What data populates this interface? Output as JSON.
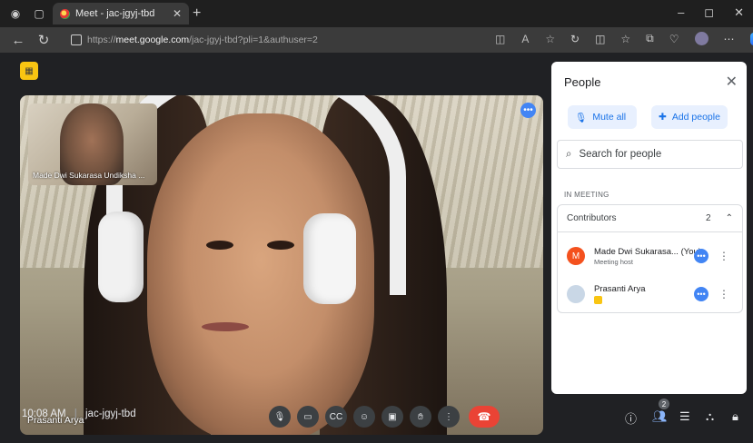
{
  "browser": {
    "tab_title": "Meet - jac-jgyj-tbd",
    "url_prefix": "https://",
    "url_host": "meet.google.com",
    "url_path": "/jac-jgyj-tbd?pli=1&authuser=2"
  },
  "meeting": {
    "time": "10:08 AM",
    "separator": "|",
    "code": "jac-jgyj-tbd",
    "main_participant": "Prasanti Arya",
    "self_tile_label": "Made Dwi Sukarasa Undiksha ...",
    "people_count": "2"
  },
  "panel": {
    "title": "People",
    "mute_all": "Mute all",
    "add_people": "Add people",
    "search_placeholder": "Search for people",
    "section_label": "IN MEETING",
    "group_label": "Contributors",
    "group_count": "2",
    "members": [
      {
        "name": "Made Dwi Sukarasa... (You)",
        "role": "Meeting host",
        "initial": "M",
        "avatar_color": "#f4511e"
      },
      {
        "name": "Prasanti Arya",
        "initial": "",
        "avatar_color": "#c9d7e6"
      }
    ]
  },
  "colors": {
    "accent_blue": "#1a73e8",
    "end_call_red": "#ea4335",
    "badge_yellow": "#f9c512"
  }
}
